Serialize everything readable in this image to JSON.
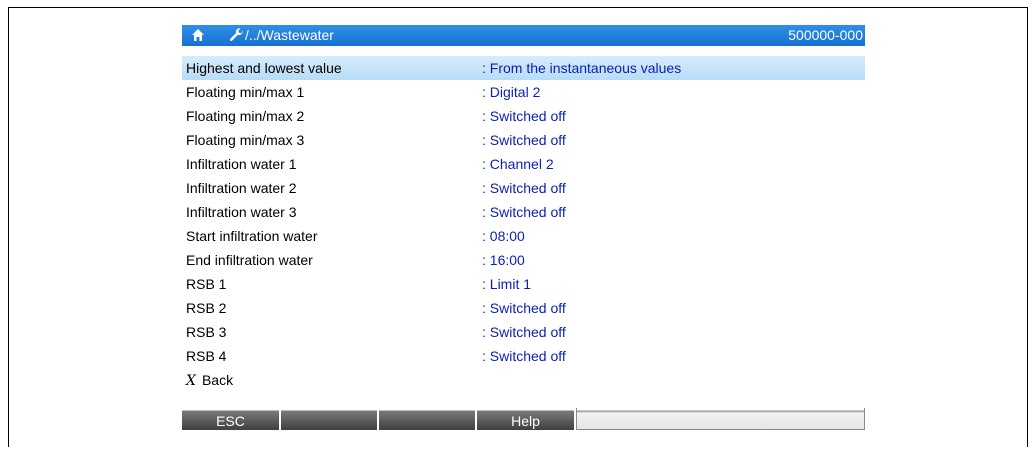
{
  "header": {
    "breadcrumb": "/../Wastewater",
    "device_id": "500000-000",
    "icons": [
      "home-icon",
      "wrench-icon"
    ]
  },
  "menu": {
    "items": [
      {
        "label": "Highest and lowest value",
        "value": ": From the instantaneous values",
        "selected": true
      },
      {
        "label": "Floating min/max 1",
        "value": ": Digital 2"
      },
      {
        "label": "Floating min/max 2",
        "value": ": Switched off"
      },
      {
        "label": "Floating min/max 3",
        "value": ": Switched off"
      },
      {
        "label": "Infiltration water 1",
        "value": ": Channel 2"
      },
      {
        "label": "Infiltration water 2",
        "value": ": Switched off"
      },
      {
        "label": "Infiltration water 3",
        "value": ": Switched off"
      },
      {
        "label": "Start infiltration water",
        "value": ": 08:00"
      },
      {
        "label": "End infiltration water",
        "value": ": 16:00"
      },
      {
        "label": "RSB 1",
        "value": ": Limit 1"
      },
      {
        "label": "RSB 2",
        "value": ": Switched off"
      },
      {
        "label": "RSB 3",
        "value": ": Switched off"
      },
      {
        "label": "RSB 4",
        "value": ": Switched off"
      }
    ],
    "back_mark": "X",
    "back_label": "Back"
  },
  "softkeys": {
    "esc": "ESC",
    "key2": "",
    "key3": "",
    "help": "Help",
    "key5": ""
  },
  "colors": {
    "title_bar": "#1f7fdc",
    "value_text": "#0a1fb3",
    "selection": "#c6e4f9"
  }
}
